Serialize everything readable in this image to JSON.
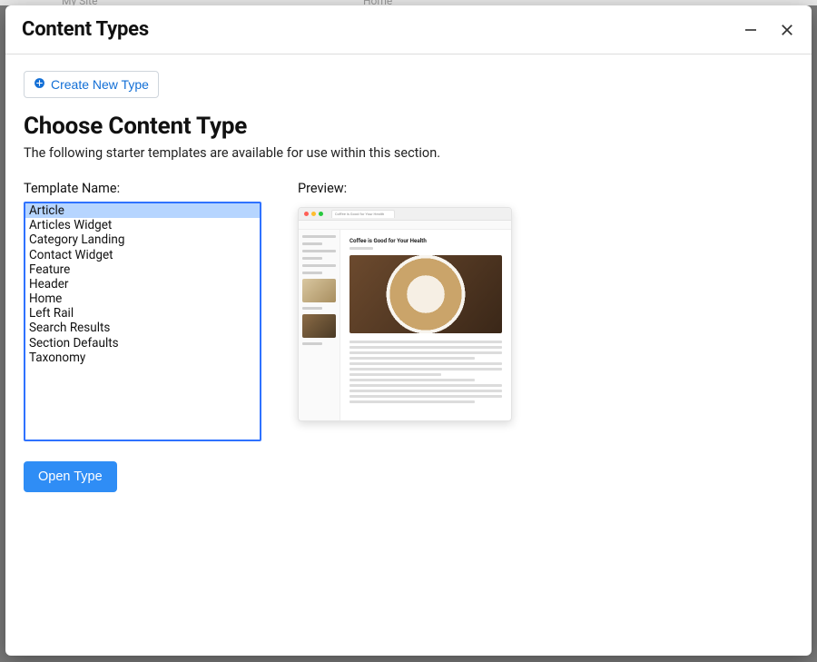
{
  "background": {
    "site_label": "My Site",
    "nav_item": "Home"
  },
  "modal": {
    "title": "Content Types",
    "create_button": "Create New Type",
    "heading": "Choose Content Type",
    "description": "The following starter templates are available for use within this section.",
    "template_label": "Template Name:",
    "preview_label": "Preview:",
    "open_button": "Open Type",
    "templates": [
      "Article",
      "Articles Widget",
      "Category Landing",
      "Contact Widget",
      "Feature",
      "Header",
      "Home",
      "Left Rail",
      "Search Results",
      "Section Defaults",
      "Taxonomy"
    ],
    "selected_template_index": 0,
    "preview": {
      "tab_title": "Coffee is Good for Your Health",
      "article_title": "Coffee is Good for Your Health"
    }
  }
}
